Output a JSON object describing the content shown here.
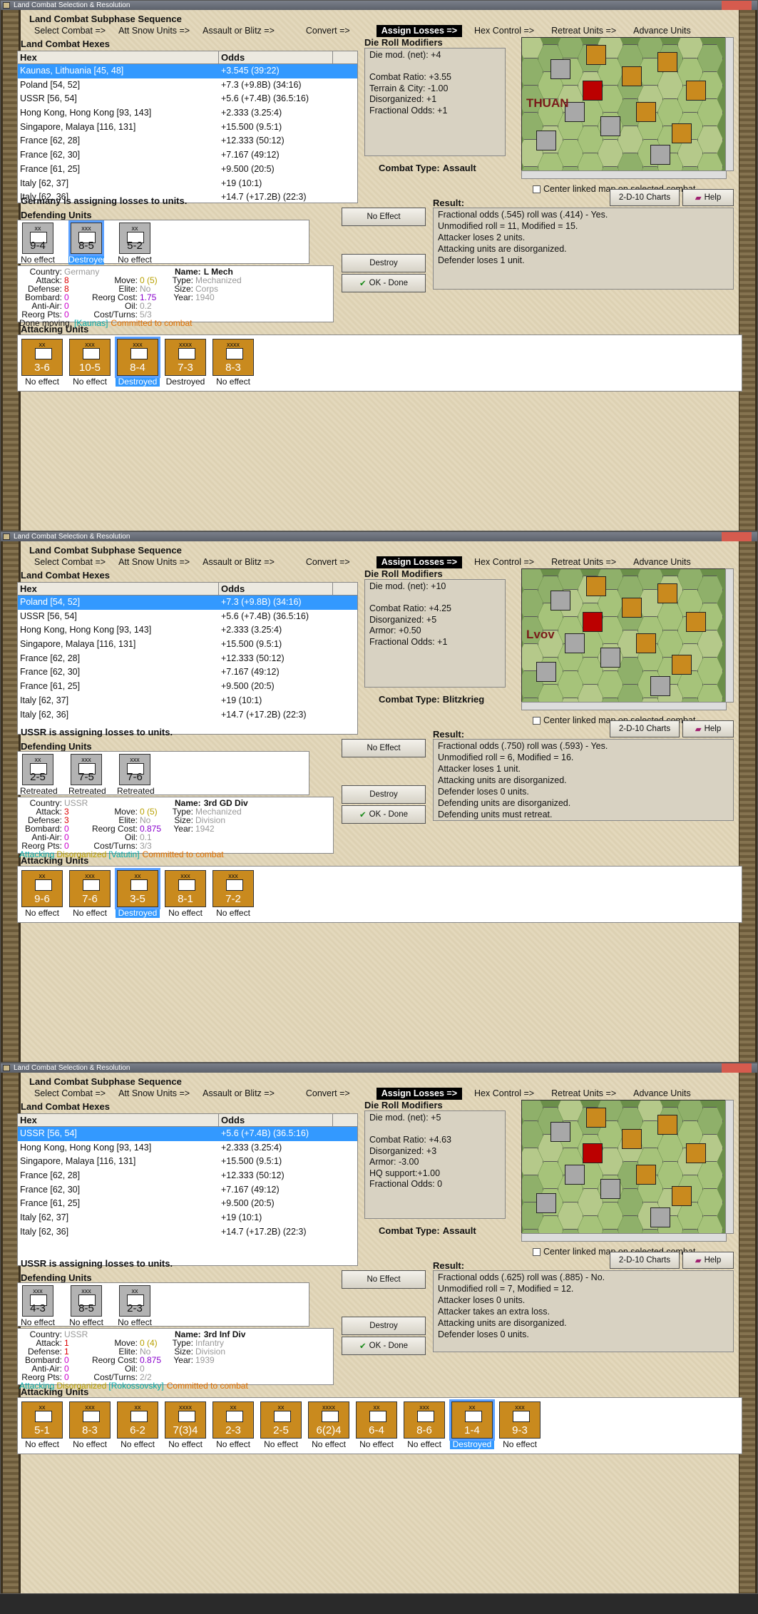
{
  "windows": [
    {
      "title": "Land Combat Selection & Resolution",
      "header": "Land Combat Subphase Sequence",
      "sequence": [
        "Select Combat =>",
        "Att Snow Units =>",
        "Assault or Blitz =>",
        "Convert =>",
        "Assign Losses =>",
        "Hex Control =>",
        "Retreat Units =>",
        "Advance Units"
      ],
      "active_step": 4,
      "hexes_label": "Land Combat Hexes",
      "columns": [
        "Hex",
        "Odds"
      ],
      "rows": [
        [
          "Kaunas, Lithuania [45, 48]",
          "+3.545 (39:22)"
        ],
        [
          "Poland [54, 52]",
          "+7.3 (+9.8B) (34:16)"
        ],
        [
          "USSR [56, 54]",
          "+5.6 (+7.4B) (36.5:16)"
        ],
        [
          "Hong Kong, Hong Kong [93, 143]",
          "+2.333 (3.25:4)"
        ],
        [
          "Singapore, Malaya [116, 131]",
          "+15.500 (9.5:1)"
        ],
        [
          "France [62, 28]",
          "+12.333 (50:12)"
        ],
        [
          "France [62, 30]",
          "+7.167 (49:12)"
        ],
        [
          "France [61, 25]",
          "+9.500 (20:5)"
        ],
        [
          "Italy [62, 37]",
          "+19 (10:1)"
        ],
        [
          "Italy [62, 36]",
          "+14.7 (+17.2B) (22:3)"
        ]
      ],
      "selected_row": 0,
      "modifiers_label": "Die Roll Modifiers",
      "modifiers": "Die mod. (net): +4\n\nCombat Ratio: +3.55\nTerrain & City: -1.00\nDisorganized: +1\nFractional Odds: +1",
      "combat_type_label": "Combat Type:",
      "combat_type": "Assault",
      "map_label": "THUAN",
      "center_map": "Center linked map on selected combat.",
      "status": "Germany is assigning losses to units.",
      "defending_label": "Defending Units",
      "defenders": [
        {
          "size": "xx",
          "value": "9-4",
          "caption": "No effect",
          "color": "g",
          "selected": false
        },
        {
          "size": "xxx",
          "value": "8-5",
          "caption": "Destroyed",
          "color": "g",
          "selected": true
        },
        {
          "size": "xx",
          "value": "5-2",
          "caption": "No effect",
          "color": "g",
          "selected": false
        }
      ],
      "buttons": {
        "no_effect": "No Effect",
        "destroy": "Destroy",
        "ok": "OK - Done",
        "charts": "2-D-10 Charts",
        "help": "Help"
      },
      "result_label": "Result:",
      "result": "Fractional odds (.545) roll was (.414)  - Yes.\nUnmodified roll = 11, Modified = 15.\nAttacker loses 2 units.\nAttacking units are disorganized.\nDefender loses 1 unit.",
      "info": {
        "country_k": "Country:",
        "country": "Germany",
        "attack_k": "Attack:",
        "attack": "8",
        "defense_k": "Defense:",
        "defense": "8",
        "bombard_k": "Bombard:",
        "bombard": "0",
        "antiair_k": "Anti-Air:",
        "antiair": "0",
        "reorg_k": "Reorg Pts:",
        "reorg": "0",
        "name_k": "Name:",
        "name": "L Mech",
        "move_k": "Move:",
        "move": "0 (5)",
        "elite_k": "Elite:",
        "elite": "No",
        "rcost_k": "Reorg Cost:",
        "rcost": "1.75",
        "oil_k": "Oil:",
        "oil": "0.2",
        "cost_k": "Cost/Turns:",
        "cost": "5/3",
        "type_k": "Type:",
        "type": "Mechanized",
        "size_k": "Size:",
        "size": "Corps",
        "year_k": "Year:",
        "year": "1940",
        "line_a": "Done moving.",
        "line_b": "[Kaunas]",
        "line_c": "Committed to combat"
      },
      "attacking_label": "Attacking Units",
      "attackers": [
        {
          "size": "xx",
          "value": "3-6",
          "caption": "No effect",
          "selected": false
        },
        {
          "size": "xxx",
          "value": "10-5",
          "caption": "No effect",
          "selected": false
        },
        {
          "size": "xxx",
          "value": "8-4",
          "caption": "Destroyed",
          "selected": true
        },
        {
          "size": "xxxx",
          "value": "7-3",
          "caption": "Destroyed",
          "selected": false
        },
        {
          "size": "xxxx",
          "value": "8-3",
          "caption": "No effect",
          "selected": false
        }
      ]
    },
    {
      "title": "Land Combat Selection & Resolution",
      "header": "Land Combat Subphase Sequence",
      "sequence": [
        "Select Combat =>",
        "Att Snow Units =>",
        "Assault or Blitz =>",
        "Convert =>",
        "Assign Losses =>",
        "Hex Control =>",
        "Retreat Units =>",
        "Advance Units"
      ],
      "active_step": 4,
      "hexes_label": "Land Combat Hexes",
      "columns": [
        "Hex",
        "Odds"
      ],
      "rows": [
        [
          "Poland [54, 52]",
          "+7.3 (+9.8B) (34:16)"
        ],
        [
          "USSR [56, 54]",
          "+5.6 (+7.4B) (36.5:16)"
        ],
        [
          "Hong Kong, Hong Kong [93, 143]",
          "+2.333 (3.25:4)"
        ],
        [
          "Singapore, Malaya [116, 131]",
          "+15.500 (9.5:1)"
        ],
        [
          "France [62, 28]",
          "+12.333 (50:12)"
        ],
        [
          "France [62, 30]",
          "+7.167 (49:12)"
        ],
        [
          "France [61, 25]",
          "+9.500 (20:5)"
        ],
        [
          "Italy [62, 37]",
          "+19 (10:1)"
        ],
        [
          "Italy [62, 36]",
          "+14.7 (+17.2B) (22:3)"
        ]
      ],
      "selected_row": 0,
      "modifiers_label": "Die Roll Modifiers",
      "modifiers": "Die mod. (net): +10\n\nCombat Ratio: +4.25\nDisorganized: +5\nArmor: +0.50\nFractional Odds: +1",
      "combat_type_label": "Combat Type:",
      "combat_type": "Blitzkrieg",
      "map_label": "Lvov",
      "center_map": "Center linked map on selected combat.",
      "status": "USSR is assigning losses to units.",
      "defending_label": "Defending Units",
      "defenders": [
        {
          "size": "xx",
          "value": "2-5",
          "caption": "Retreated",
          "color": "g",
          "selected": false
        },
        {
          "size": "xxx",
          "value": "7-5",
          "caption": "Retreated",
          "color": "g",
          "selected": false
        },
        {
          "size": "xxx",
          "value": "7-6",
          "caption": "Retreated",
          "color": "g",
          "selected": false
        }
      ],
      "buttons": {
        "no_effect": "No Effect",
        "destroy": "Destroy",
        "ok": "OK - Done",
        "charts": "2-D-10 Charts",
        "help": "Help"
      },
      "result_label": "Result:",
      "result": "Fractional odds (.750) roll was (.593)  - Yes.\nUnmodified roll = 6, Modified = 16.\nAttacker loses 1 unit.\nAttacking units are disorganized.\nDefender loses 0 units.\nDefending units are disorganized.\nDefending units must retreat.",
      "info": {
        "country_k": "Country:",
        "country": "USSR",
        "attack_k": "Attack:",
        "attack": "3",
        "defense_k": "Defense:",
        "defense": "3",
        "bombard_k": "Bombard:",
        "bombard": "0",
        "antiair_k": "Anti-Air:",
        "antiair": "0",
        "reorg_k": "Reorg Pts:",
        "reorg": "0",
        "name_k": "Name:",
        "name": "3rd GD Div",
        "move_k": "Move:",
        "move": "0 (5)",
        "elite_k": "Elite:",
        "elite": "No",
        "rcost_k": "Reorg Cost:",
        "rcost": "0.875",
        "oil_k": "Oil:",
        "oil": "0.1",
        "cost_k": "Cost/Turns:",
        "cost": "3/3",
        "type_k": "Type:",
        "type": "Mechanized",
        "size_k": "Size:",
        "size": "Division",
        "year_k": "Year:",
        "year": "1942",
        "line_a": "Attacking",
        "line_a2": "Disorganized",
        "line_b": "[Vatutin]",
        "line_c": "Committed to combat"
      },
      "attacking_label": "Attacking Units",
      "attackers": [
        {
          "size": "xx",
          "value": "9-6",
          "caption": "No effect",
          "selected": false
        },
        {
          "size": "xxx",
          "value": "7-6",
          "caption": "No effect",
          "selected": false
        },
        {
          "size": "xx",
          "value": "3-5",
          "caption": "Destroyed",
          "selected": true
        },
        {
          "size": "xxx",
          "value": "8-1",
          "caption": "No effect",
          "selected": false
        },
        {
          "size": "xxx",
          "value": "7-2",
          "caption": "No effect",
          "selected": false
        }
      ]
    },
    {
      "title": "Land Combat Selection & Resolution",
      "header": "Land Combat Subphase Sequence",
      "sequence": [
        "Select Combat =>",
        "Att Snow Units =>",
        "Assault or Blitz =>",
        "Convert =>",
        "Assign Losses =>",
        "Hex Control =>",
        "Retreat Units =>",
        "Advance Units"
      ],
      "active_step": 4,
      "hexes_label": "Land Combat Hexes",
      "columns": [
        "Hex",
        "Odds"
      ],
      "rows": [
        [
          "USSR [56, 54]",
          "+5.6 (+7.4B) (36.5:16)"
        ],
        [
          "Hong Kong, Hong Kong [93, 143]",
          "+2.333 (3.25:4)"
        ],
        [
          "Singapore, Malaya [116, 131]",
          "+15.500 (9.5:1)"
        ],
        [
          "France [62, 28]",
          "+12.333 (50:12)"
        ],
        [
          "France [62, 30]",
          "+7.167 (49:12)"
        ],
        [
          "France [61, 25]",
          "+9.500 (20:5)"
        ],
        [
          "Italy [62, 37]",
          "+19 (10:1)"
        ],
        [
          "Italy [62, 36]",
          "+14.7 (+17.2B) (22:3)"
        ]
      ],
      "selected_row": 0,
      "modifiers_label": "Die Roll Modifiers",
      "modifiers": "Die mod. (net): +5\n\nCombat Ratio: +4.63\nDisorganized: +3\nArmor: -3.00\nHQ support:+1.00\nFractional Odds: 0",
      "combat_type_label": "Combat Type:",
      "combat_type": "Assault",
      "map_label": "",
      "center_map": "Center linked map on selected combat.",
      "status": "USSR is assigning losses to units.",
      "defending_label": "Defending Units",
      "defenders": [
        {
          "size": "xxx",
          "value": "4-3",
          "caption": "No effect",
          "color": "g",
          "selected": false
        },
        {
          "size": "xxx",
          "value": "8-5",
          "caption": "No effect",
          "color": "g",
          "selected": false
        },
        {
          "size": "xx",
          "value": "2-3",
          "caption": "No effect",
          "color": "g",
          "selected": false
        }
      ],
      "buttons": {
        "no_effect": "No Effect",
        "destroy": "Destroy",
        "ok": "OK - Done",
        "charts": "2-D-10 Charts",
        "help": "Help"
      },
      "result_label": "Result:",
      "result": "Fractional odds (.625) roll was (.885)  - No.\nUnmodified roll = 7, Modified = 12.\nAttacker loses 0 units.\nAttacker takes an extra loss.\nAttacking units are disorganized.\nDefender loses 0 units.",
      "info": {
        "country_k": "Country:",
        "country": "USSR",
        "attack_k": "Attack:",
        "attack": "1",
        "defense_k": "Defense:",
        "defense": "1",
        "bombard_k": "Bombard:",
        "bombard": "0",
        "antiair_k": "Anti-Air:",
        "antiair": "0",
        "reorg_k": "Reorg Pts:",
        "reorg": "0",
        "name_k": "Name:",
        "name": "3rd Inf Div",
        "move_k": "Move:",
        "move": "0 (4)",
        "elite_k": "Elite:",
        "elite": "No",
        "rcost_k": "Reorg Cost:",
        "rcost": "0.875",
        "oil_k": "Oil:",
        "oil": "0",
        "cost_k": "Cost/Turns:",
        "cost": "2/2",
        "type_k": "Type:",
        "type": "Infantry",
        "size_k": "Size:",
        "size": "Division",
        "year_k": "Year:",
        "year": "1939",
        "line_a": "Attacking",
        "line_a2": "Disorganized",
        "line_b": "[Rokossovsky]",
        "line_c": "Committed to combat"
      },
      "attacking_label": "Attacking Units",
      "attackers": [
        {
          "size": "xx",
          "value": "5-1",
          "caption": "No effect",
          "selected": false
        },
        {
          "size": "xxx",
          "value": "8-3",
          "caption": "No effect",
          "selected": false
        },
        {
          "size": "xx",
          "value": "6-2",
          "caption": "No effect",
          "selected": false
        },
        {
          "size": "xxxx",
          "value": "7(3)4",
          "caption": "No effect",
          "selected": false
        },
        {
          "size": "xx",
          "value": "2-3",
          "caption": "No effect",
          "selected": false
        },
        {
          "size": "xx",
          "value": "2-5",
          "caption": "No effect",
          "selected": false
        },
        {
          "size": "xxxx",
          "value": "6(2)4",
          "caption": "No effect",
          "selected": false
        },
        {
          "size": "xx",
          "value": "6-4",
          "caption": "No effect",
          "selected": false
        },
        {
          "size": "xxx",
          "value": "8-6",
          "caption": "No effect",
          "selected": false
        },
        {
          "size": "xx",
          "value": "1-4",
          "caption": "Destroyed",
          "selected": true
        },
        {
          "size": "xxx",
          "value": "9-3",
          "caption": "No effect",
          "selected": false
        }
      ]
    }
  ],
  "colors": {
    "selection": "#3399ff",
    "active_step": "#000000",
    "counter_orange": "#c98a1e",
    "counter_grey": "#b3b3b3"
  }
}
